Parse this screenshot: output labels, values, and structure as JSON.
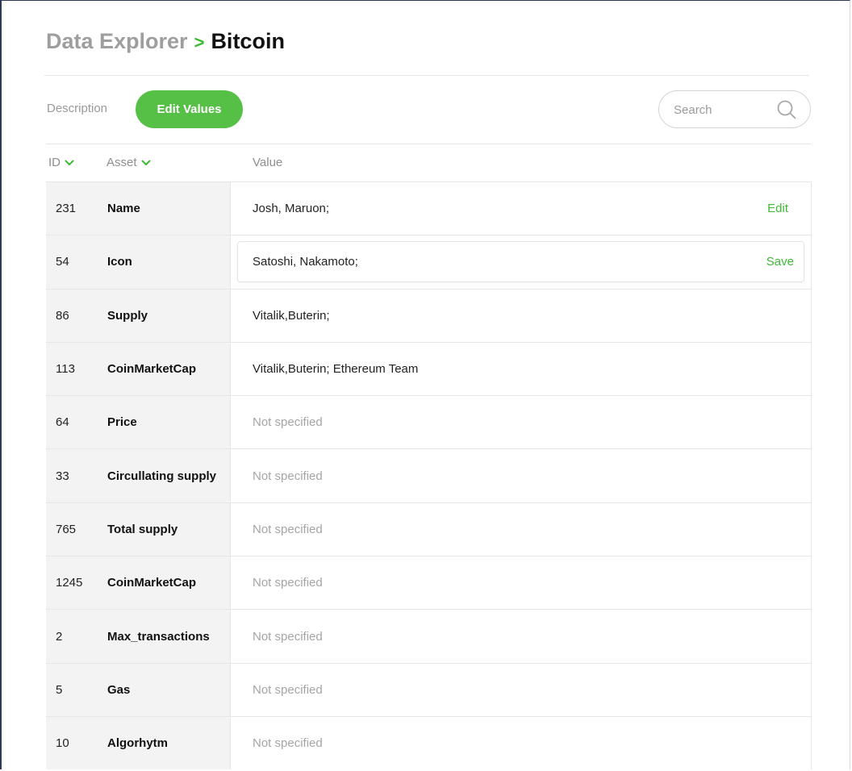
{
  "breadcrumb": {
    "root": "Data Explorer",
    "separator": ">",
    "current": "Bitcoin"
  },
  "tabs": {
    "description": "Description",
    "edit_values": "Edit Values"
  },
  "search": {
    "placeholder": "Search",
    "icon": "search-icon"
  },
  "columns": {
    "id": "ID",
    "asset": "Asset",
    "value": "Value"
  },
  "colors": {
    "accent": "#56bf45",
    "accent_text": "#3dbb34",
    "muted": "#9e9e9e"
  },
  "rows": [
    {
      "id": "231",
      "asset": "Name",
      "value": "Josh, Maruon;",
      "action": "Edit"
    },
    {
      "id": "54",
      "asset": "Icon",
      "value": "Satoshi, Nakamoto;",
      "action": "Save",
      "editing": true
    },
    {
      "id": "86",
      "asset": "Supply",
      "value": "Vitalik,Buterin;"
    },
    {
      "id": "113",
      "asset": "CoinMarketCap",
      "value": "Vitalik,Buterin; Ethereum Team"
    },
    {
      "id": "64",
      "asset": "Price",
      "value": "Not specified",
      "empty": true
    },
    {
      "id": "33",
      "asset": "Circullating supply",
      "value": "Not specified",
      "empty": true
    },
    {
      "id": "765",
      "asset": "Total supply",
      "value": "Not specified",
      "empty": true
    },
    {
      "id": "1245",
      "asset": "CoinMarketCap",
      "value": "Not specified",
      "empty": true
    },
    {
      "id": "2",
      "asset": "Max_transactions",
      "value": "Not specified",
      "empty": true
    },
    {
      "id": "5",
      "asset": "Gas",
      "value": "Not specified",
      "empty": true
    },
    {
      "id": "10",
      "asset": "Algorhytm",
      "value": "Not specified",
      "empty": true
    }
  ]
}
